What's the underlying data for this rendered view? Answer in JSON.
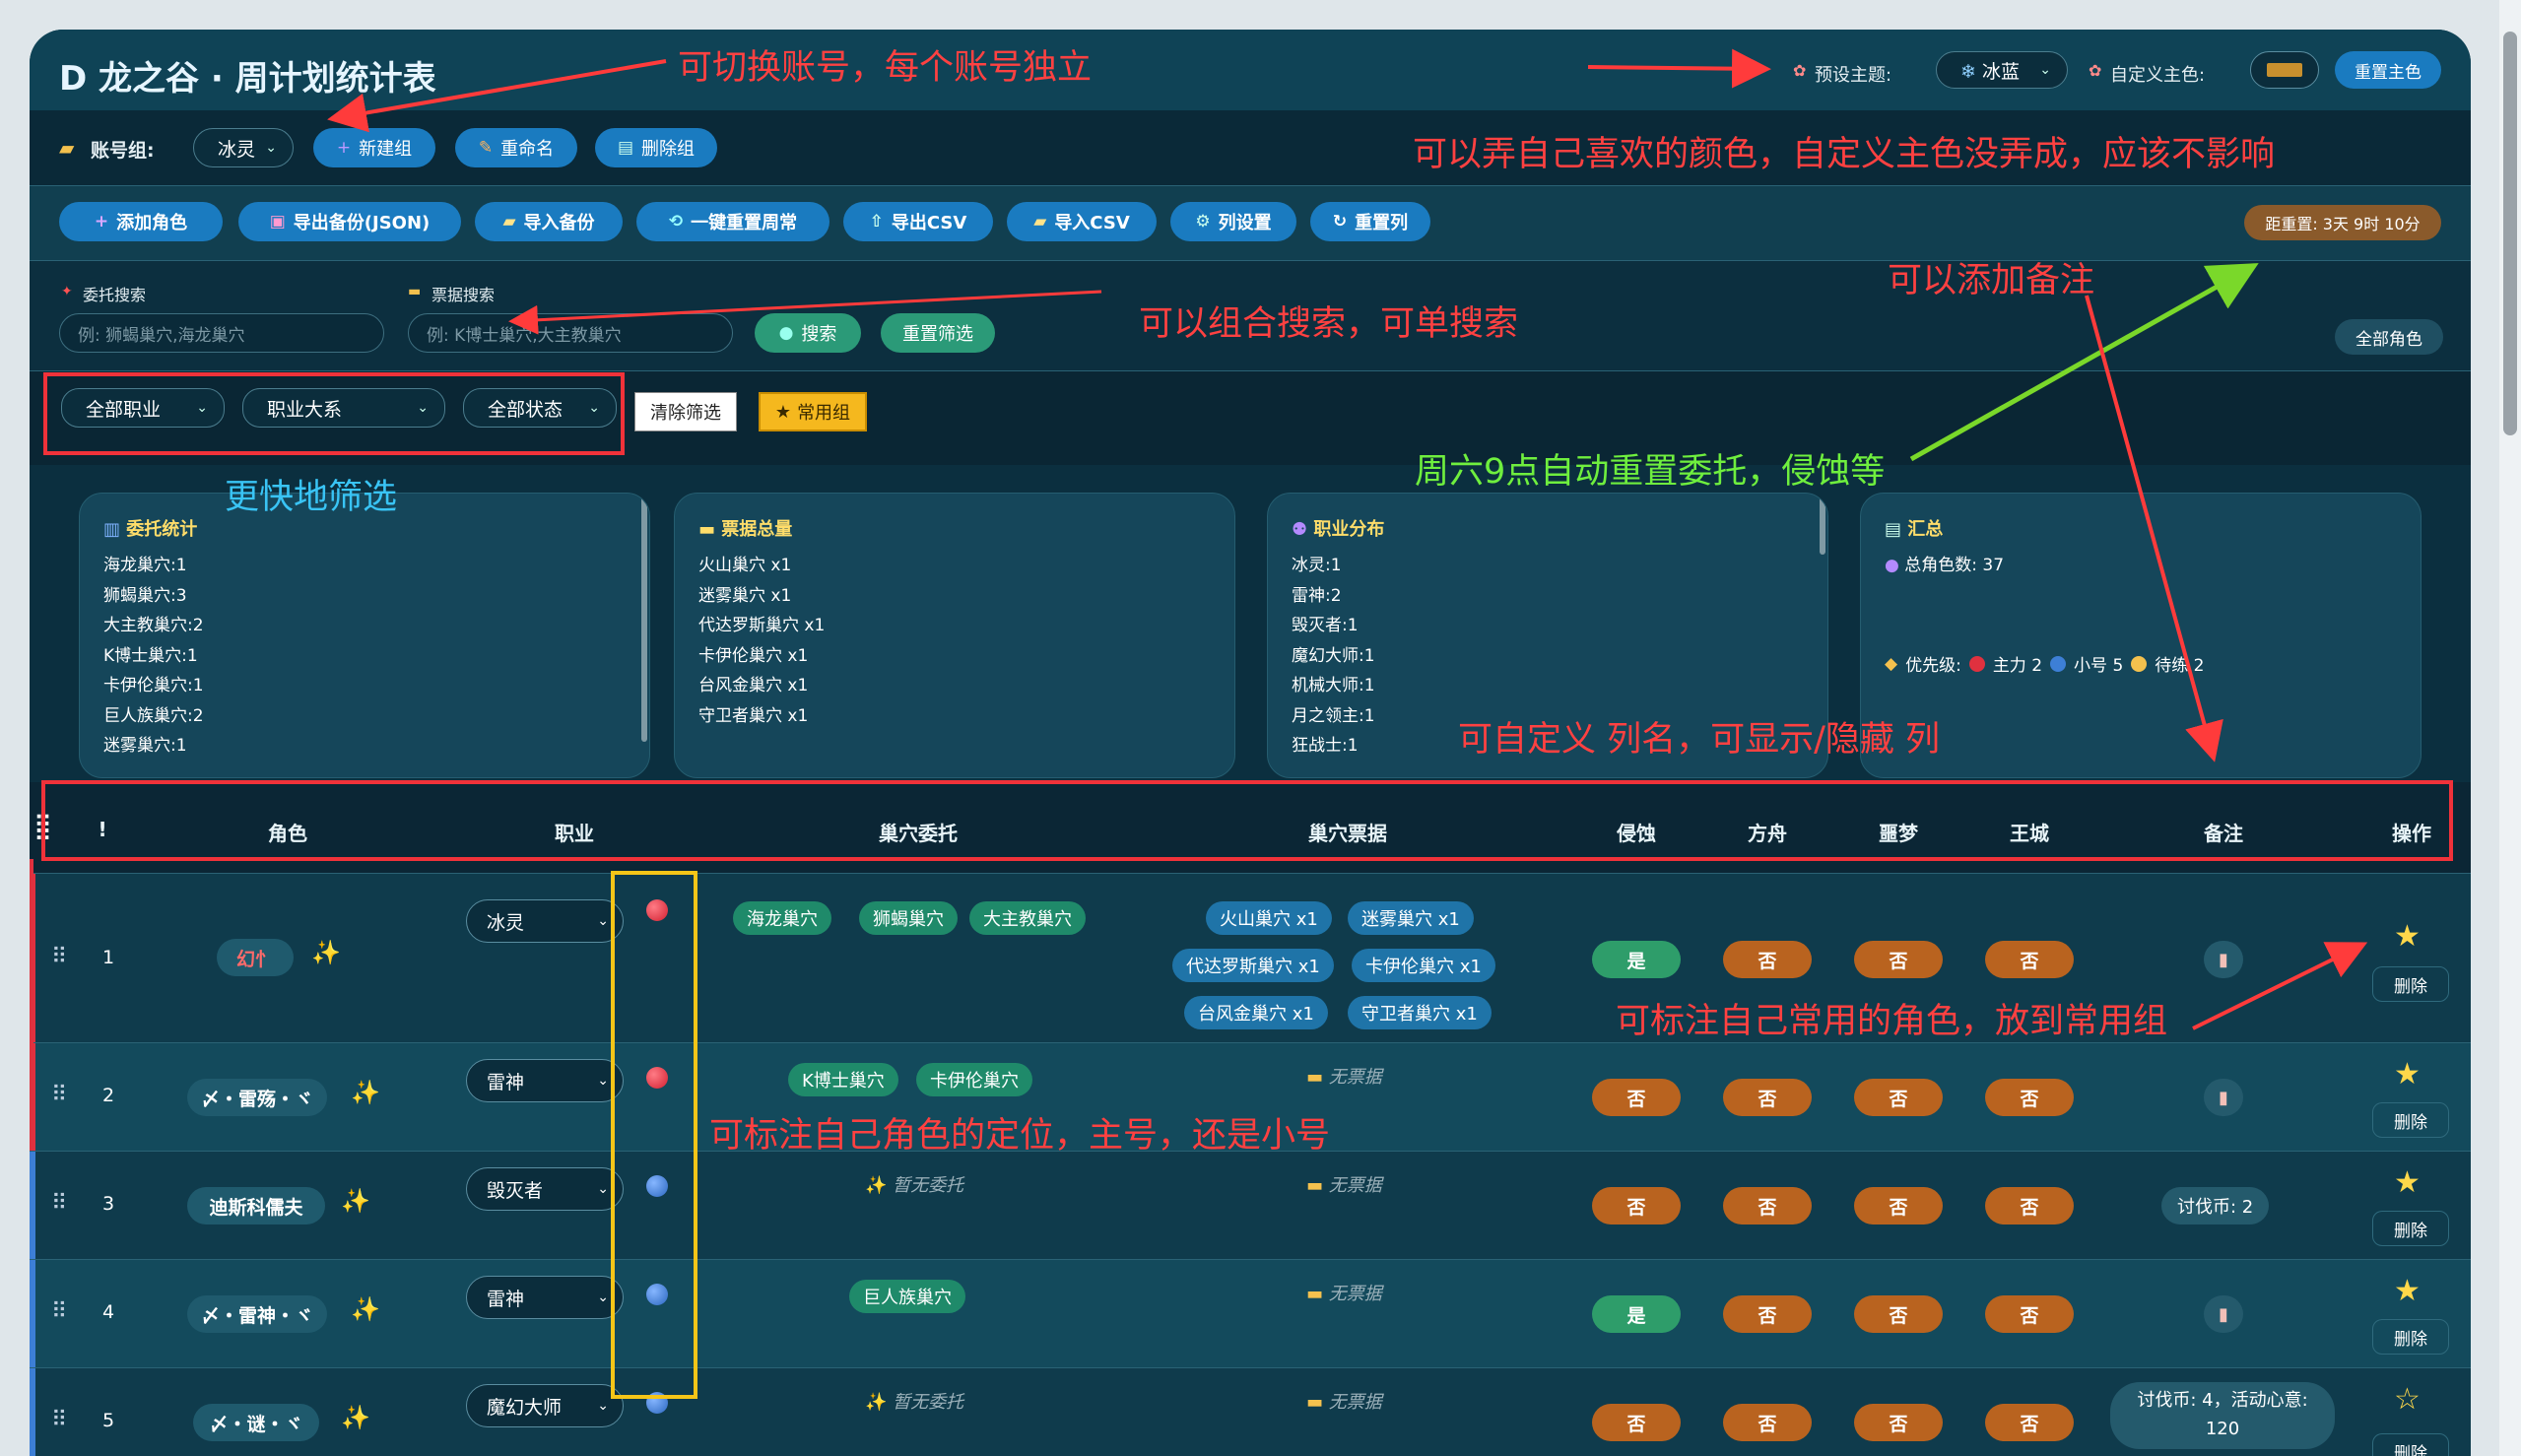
{
  "header": {
    "title": "D 龙之谷 · 周计划统计表",
    "theme_label": "预设主题:",
    "theme_value": "冰蓝",
    "custom_color_label": "自定义主色:",
    "custom_color": "#c8902e",
    "reset_color": "重置主色"
  },
  "account": {
    "label": "账号组:",
    "selected": "冰灵",
    "new_group": "新建组",
    "rename": "重命名",
    "delete_group": "删除组"
  },
  "toolbar": {
    "add_role": "添加角色",
    "export_json": "导出备份(JSON)",
    "import_backup": "导入备份",
    "reset_weekly": "一键重置周常",
    "export_csv": "导出CSV",
    "import_csv": "导入CSV",
    "column_settings": "列设置",
    "reset_columns": "重置列",
    "countdown": "距重置: 3天 9时 10分"
  },
  "search": {
    "commission_label": "委托搜索",
    "commission_placeholder": "例: 狮蝎巢穴,海龙巢穴",
    "ticket_label": "票据搜索",
    "ticket_placeholder": "例: K博士巢穴,大主教巢穴",
    "search_btn": "搜索",
    "reset_filter": "重置筛选",
    "all_roles": "全部角色"
  },
  "filters": {
    "job": "全部职业",
    "job_family": "职业大系",
    "status": "全部状态",
    "clear": "清除筛选",
    "favorites": "常用组"
  },
  "stats": {
    "commission_title": "委托统计",
    "commission_lines": [
      "海龙巢穴:1",
      "狮蝎巢穴:3",
      "大主教巢穴:2",
      "K博士巢穴:1",
      "卡伊伦巢穴:1",
      "巨人族巢穴:2",
      "迷雾巢穴:1"
    ],
    "tickets_title": "票据总量",
    "ticket_lines": [
      "火山巢穴 x1",
      "迷雾巢穴 x1",
      "代达罗斯巢穴 x1",
      "卡伊伦巢穴 x1",
      "台风金巢穴 x1",
      "守卫者巢穴 x1"
    ],
    "jobs_title": "职业分布",
    "job_lines": [
      "冰灵:1",
      "雷神:2",
      "毁灭者:1",
      "魔幻大师:1",
      "机械大师:1",
      "月之领主:1",
      "狂战士:1"
    ],
    "summary_title": "汇总",
    "total_roles": "总角色数: 37",
    "priority_label": "优先级:",
    "priority_main": "主力 2",
    "priority_alt": "小号 5",
    "priority_train": "待练 2"
  },
  "table": {
    "headers": [
      "!",
      "角色",
      "职业",
      "巢穴委托",
      "巢穴票据",
      "侵蚀",
      "方舟",
      "噩梦",
      "王城",
      "备注",
      "操作"
    ],
    "no_commission": "暂无委托",
    "no_ticket": "无票据",
    "delete": "删除",
    "rows": [
      {
        "idx": "1",
        "name": "幻忄",
        "job": "冰灵",
        "commissions": [
          "海龙巢穴",
          "狮蝎巢穴",
          "大主教巢穴"
        ],
        "tickets": [
          "火山巢穴 x1",
          "迷雾巢穴 x1",
          "代达罗斯巢穴 x1",
          "卡伊伦巢穴 x1",
          "台风金巢穴 x1",
          "守卫者巢穴 x1"
        ],
        "erosion": "是",
        "ark": "否",
        "nightmare": "否",
        "royal": "否",
        "note": "",
        "starred": true
      },
      {
        "idx": "2",
        "name": "〆・雷殇・ヾ",
        "job": "雷神",
        "commissions": [
          "K博士巢穴",
          "卡伊伦巢穴"
        ],
        "tickets": [],
        "erosion": "否",
        "ark": "否",
        "nightmare": "否",
        "royal": "否",
        "note": "",
        "starred": true
      },
      {
        "idx": "3",
        "name": "迪斯科儒夫",
        "job": "毁灭者",
        "commissions": [],
        "tickets": [],
        "erosion": "否",
        "ark": "否",
        "nightmare": "否",
        "royal": "否",
        "note": "讨伐币: 2",
        "starred": true
      },
      {
        "idx": "4",
        "name": "〆・雷神・ヾ",
        "job": "雷神",
        "commissions": [
          "巨人族巢穴"
        ],
        "tickets": [],
        "erosion": "是",
        "ark": "否",
        "nightmare": "否",
        "royal": "否",
        "note": "",
        "starred": true
      },
      {
        "idx": "5",
        "name": "〆・谜・ヾ",
        "job": "魔幻大师",
        "commissions": [],
        "tickets": [],
        "erosion": "否",
        "ark": "否",
        "nightmare": "否",
        "royal": "否",
        "note": "讨伐币: 4，活动心意: 120",
        "starred": false
      }
    ]
  },
  "annotations": {
    "switch_account": "可切换账号，每个账号独立",
    "custom_color": "可以弄自己喜欢的颜色，自定义主色没弄成，应该不影响",
    "add_note": "可以添加备注",
    "combo_search": "可以组合搜索，可单搜索",
    "weekly_reset": "周六9点自动重置委托，侵蚀等",
    "quick_filter": "更快地筛选",
    "custom_columns": "可自定义 列名，可显示/隐藏 列",
    "mark_favorite": "可标注自己常用的角色，放到常用组",
    "mark_role": "可标注自己角色的定位，主号，还是小号"
  },
  "colors": {
    "main_dot": "#e0313f",
    "alt_dot": "#3d7fd6",
    "annotation_red": "#ff4141",
    "annotation_green": "#6fef3e",
    "annotation_blue": "#39c4f5",
    "highlight_yellow": "#f5c518"
  }
}
